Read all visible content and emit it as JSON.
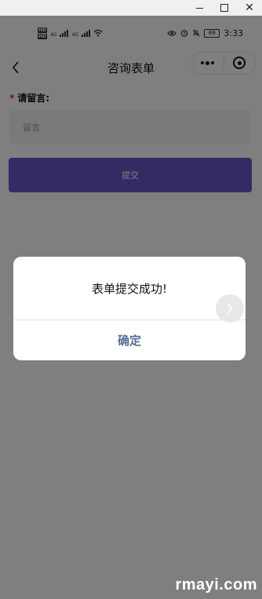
{
  "window": {
    "minimize_label": "",
    "close_label": "✕"
  },
  "statusbar": {
    "hd_top": "HD",
    "hd_bottom": "HD",
    "net1": "4G",
    "net2": "4G",
    "battery": "69",
    "time": "3:33"
  },
  "navbar": {
    "title": "咨询表单"
  },
  "form": {
    "required_mark": "*",
    "label": "请留言:",
    "placeholder": "留言",
    "submit_label": "提交"
  },
  "modal": {
    "message": "表单提交成功!",
    "confirm_label": "确定"
  },
  "watermark": "rmayi.com",
  "colors": {
    "accent": "#6a55c8",
    "confirm": "#576b95",
    "required": "#e02020"
  }
}
